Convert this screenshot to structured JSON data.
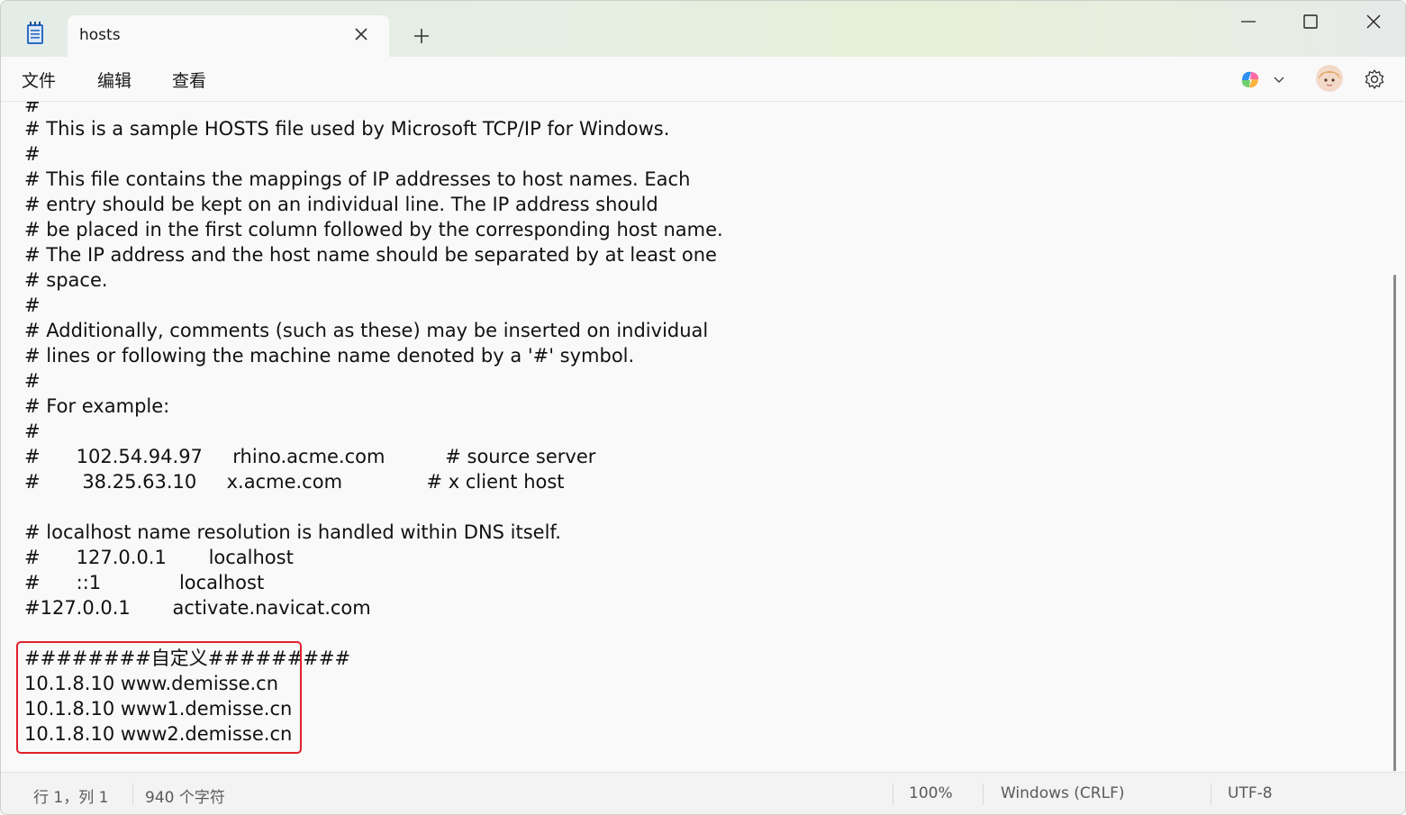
{
  "tab": {
    "title": "hosts"
  },
  "menu": {
    "file": "文件",
    "edit": "编辑",
    "view": "查看"
  },
  "editor": {
    "lines": [
      "#",
      "# This is a sample HOSTS file used by Microsoft TCP/IP for Windows.",
      "#",
      "# This file contains the mappings of IP addresses to host names. Each",
      "# entry should be kept on an individual line. The IP address should",
      "# be placed in the first column followed by the corresponding host name.",
      "# The IP address and the host name should be separated by at least one",
      "# space.",
      "#",
      "# Additionally, comments (such as these) may be inserted on individual",
      "# lines or following the machine name denoted by a '#' symbol.",
      "#",
      "# For example:",
      "#",
      "#      102.54.94.97     rhino.acme.com          # source server",
      "#       38.25.63.10     x.acme.com              # x client host",
      "",
      "# localhost name resolution is handled within DNS itself.",
      "#      127.0.0.1       localhost",
      "#      ::1             localhost",
      "#127.0.0.1       activate.navicat.com",
      "",
      "########自定义#########",
      "10.1.8.10 www.demisse.cn",
      "10.1.8.10 www1.demisse.cn",
      "10.1.8.10 www2.demisse.cn"
    ]
  },
  "status": {
    "position": "行 1，列 1",
    "chars": "940 个字符",
    "zoom": "100%",
    "line_ending": "Windows (CRLF)",
    "encoding": "UTF-8"
  },
  "colors": {
    "highlight": "#e0202a"
  }
}
